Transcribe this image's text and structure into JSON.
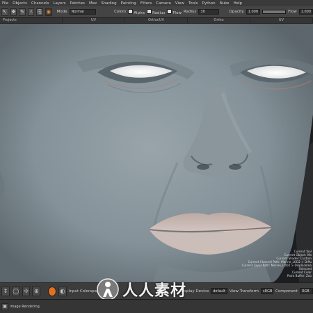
{
  "menubar": {
    "items": [
      "File",
      "Objects",
      "Channels",
      "Layers",
      "Patches",
      "Mex",
      "Shading",
      "Painting",
      "Filters",
      "Camera",
      "View",
      "Tools",
      "Python",
      "Nuke",
      "Help"
    ]
  },
  "toolbar": {
    "mode_label": "Mode",
    "mode_value": "Normal",
    "colors_label": "Colors",
    "alpha_label": "Alpha",
    "radius_label": "Radius",
    "flow_label": "Flow",
    "radius_label2": "Radius",
    "radius_value": "30",
    "opacity_label": "Opacity",
    "opacity_value": "1.000",
    "flow_label2": "Flow",
    "flow_value": "1.000",
    "opacity_fraction": 1.0,
    "flow_fraction": 1.0,
    "icons": [
      "pointer-icon",
      "transform-icon",
      "brush-icon",
      "smudge-icon",
      "clone-icon",
      "paint-icon"
    ]
  },
  "tabs": [
    "Projects",
    "UV",
    "Ortho/UV",
    "Ortho",
    "UV"
  ],
  "hud": {
    "lines": [
      "Current Tool",
      "Current Object: Ma",
      "Current Shader: Custom",
      "Current Channel Path: Marine_LOD2 > Diffu",
      "Current Layer Path: Marine_LOD2 > Displaceme",
      "Selected",
      "Current Color",
      "Paint Buffer: Zoo"
    ]
  },
  "bottombar": {
    "input_colorspace_label": "Input Colorspace",
    "display_device_label": "Display Device",
    "display_device_value": "default",
    "view_transform_label": "View Transform",
    "view_transform_value": "sRGB",
    "component_label": "Component",
    "component_value": "RGB"
  },
  "watermark": {
    "text": "人人素材",
    "logo": "man-logo"
  },
  "statusbar": {
    "text": "Image Rendering"
  },
  "colors": {
    "accent": "#e0711f",
    "skin": "#8f9aa0",
    "eye": "#f2f2f2",
    "lip": "#c4b5af"
  }
}
